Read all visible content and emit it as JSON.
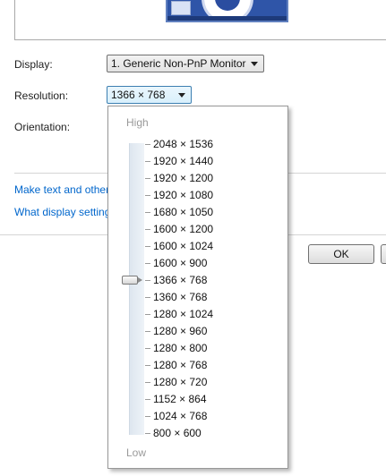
{
  "display": {
    "label": "Display:",
    "value": "1. Generic Non-PnP Monitor"
  },
  "resolution": {
    "label": "Resolution:",
    "value": "1366 × 768"
  },
  "orientation": {
    "label": "Orientation:"
  },
  "links": {
    "text_size": "Make text and other",
    "display_settings": "What display setting"
  },
  "buttons": {
    "ok": "OK"
  },
  "resolution_popup": {
    "high_label": "High",
    "low_label": "Low",
    "selected_index": 8,
    "options": [
      "2048 × 1536",
      "1920 × 1440",
      "1920 × 1200",
      "1920 × 1080",
      "1680 × 1050",
      "1600 × 1200",
      "1600 × 1024",
      "1600 × 900",
      "1366 × 768",
      "1360 × 768",
      "1280 × 1024",
      "1280 × 960",
      "1280 × 800",
      "1280 × 768",
      "1280 × 720",
      "1152 × 864",
      "1024 × 768",
      "800 × 600"
    ]
  },
  "colors": {
    "link": "#0066cc",
    "accent": "#3c7fb1"
  }
}
